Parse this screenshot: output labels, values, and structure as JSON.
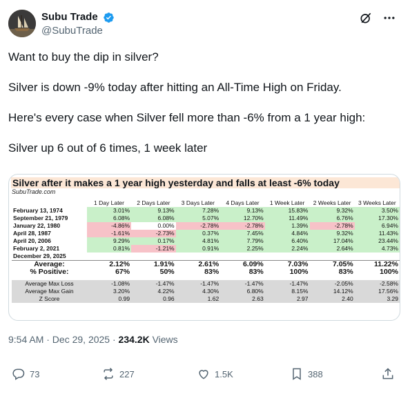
{
  "author": {
    "display_name": "Subu Trade",
    "handle": "@SubuTrade"
  },
  "tweet": {
    "lines": [
      "Want to buy the dip in silver?",
      "Silver is down -9% today after hitting an All-Time High on Friday.",
      "Here's every case when Silver fell more than -6% from a 1 year high:",
      "Silver up 6 out of 6 times, 1 week later"
    ]
  },
  "table": {
    "title": "Silver after it makes a 1 year high yesterday and falls at least -6% today",
    "source": "SubuTrade.com",
    "columns": [
      "",
      "1 Day Later",
      "2 Days Later",
      "3 Days Later",
      "4 Days Later",
      "1 Week Later",
      "2 Weeks Later",
      "3 Weeks Later"
    ],
    "rows": [
      {
        "date": "February 13, 1974",
        "values": [
          "3.01%",
          "9.13%",
          "7.28%",
          "9.13%",
          "15.83%",
          "9.32%",
          "3.50%"
        ],
        "signs": [
          "pos",
          "pos",
          "pos",
          "pos",
          "pos",
          "pos",
          "pos"
        ]
      },
      {
        "date": "September 21, 1979",
        "values": [
          "6.08%",
          "6.08%",
          "5.07%",
          "12.70%",
          "11.49%",
          "6.76%",
          "17.30%"
        ],
        "signs": [
          "pos",
          "pos",
          "pos",
          "pos",
          "pos",
          "pos",
          "pos"
        ]
      },
      {
        "date": "January 22, 1980",
        "values": [
          "-4.86%",
          "0.00%",
          "-2.78%",
          "-2.78%",
          "1.39%",
          "-2.78%",
          "6.94%"
        ],
        "signs": [
          "neg",
          "neu",
          "neg",
          "neg",
          "pos",
          "neg",
          "pos"
        ]
      },
      {
        "date": "April 28, 1987",
        "values": [
          "-1.61%",
          "-2.73%",
          "0.37%",
          "7.45%",
          "4.84%",
          "9.32%",
          "11.43%"
        ],
        "signs": [
          "neg",
          "neg",
          "pos",
          "pos",
          "pos",
          "pos",
          "pos"
        ]
      },
      {
        "date": "April 20, 2006",
        "values": [
          "9.29%",
          "0.17%",
          "4.81%",
          "7.79%",
          "6.40%",
          "17.04%",
          "23.44%"
        ],
        "signs": [
          "pos",
          "pos",
          "pos",
          "pos",
          "pos",
          "pos",
          "pos"
        ]
      },
      {
        "date": "February 2, 2021",
        "values": [
          "0.81%",
          "-1.21%",
          "0.91%",
          "2.25%",
          "2.24%",
          "2.64%",
          "4.73%"
        ],
        "signs": [
          "pos",
          "neg",
          "pos",
          "pos",
          "pos",
          "pos",
          "pos"
        ]
      },
      {
        "date": "December 29, 2025",
        "values": [
          "",
          "",
          "",
          "",
          "",
          "",
          ""
        ],
        "signs": [
          "neu",
          "neu",
          "neu",
          "neu",
          "neu",
          "neu",
          "neu"
        ]
      }
    ],
    "average": {
      "label": "Average:",
      "values": [
        "2.12%",
        "1.91%",
        "2.61%",
        "6.09%",
        "7.03%",
        "7.05%",
        "11.22%"
      ]
    },
    "positive": {
      "label": "% Positive:",
      "values": [
        "67%",
        "50%",
        "83%",
        "83%",
        "100%",
        "83%",
        "100%"
      ]
    },
    "bottom_rows": [
      {
        "label": "Average Max Loss",
        "values": [
          "-1.08%",
          "-1.47%",
          "-1.47%",
          "-1.47%",
          "-1.47%",
          "-2.05%",
          "-2.58%"
        ]
      },
      {
        "label": "Average Max Gain",
        "values": [
          "3.20%",
          "4.22%",
          "4.30%",
          "6.80%",
          "8.15%",
          "14.12%",
          "17.56%"
        ]
      },
      {
        "label": "Z Score",
        "values": [
          "0.99",
          "0.96",
          "1.62",
          "2.63",
          "2.97",
          "2.40",
          "3.29"
        ]
      }
    ]
  },
  "meta": {
    "time": "9:54 AM · Dec 29, 2025 · ",
    "views_count": "234.2K",
    "views_label": " Views"
  },
  "actions": {
    "replies": "73",
    "reposts": "227",
    "likes": "1.5K",
    "bookmarks": "388"
  },
  "colors": {
    "verified": "#1d9bf0",
    "positive_cell": "#c9f0c9",
    "negative_cell": "#f7c2c8",
    "title_bg": "#fce7d6"
  }
}
